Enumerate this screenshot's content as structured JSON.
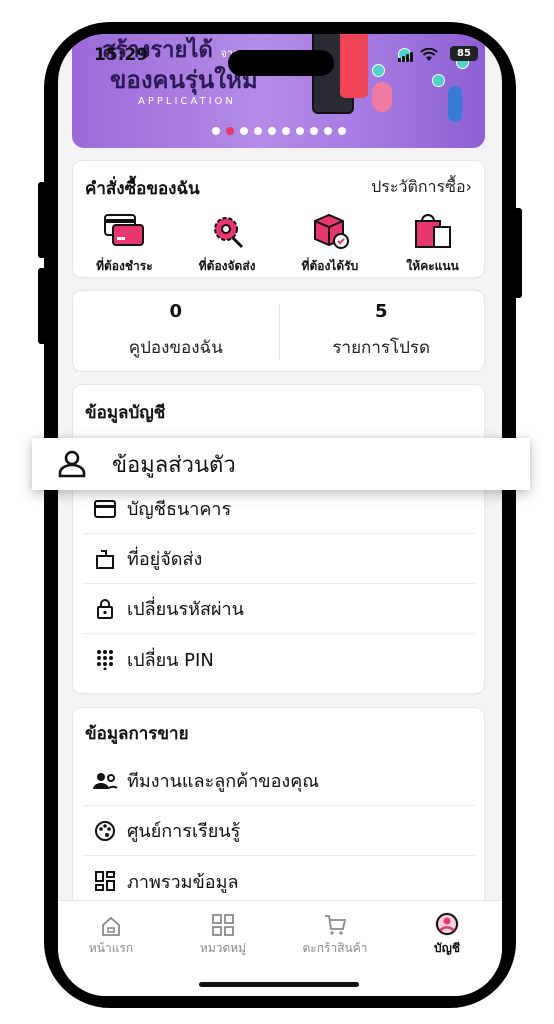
{
  "status": {
    "time": "15:29",
    "battery": "85"
  },
  "banner": {
    "line1": "สร้างรายได้",
    "line1_small": "จาก แอพ",
    "line2": "ของคนรุ่นใหม่",
    "line3": "APPLICATION",
    "dot_count": 10,
    "active_dot": 1
  },
  "orders": {
    "title": "คำสั่งซื้อของฉัน",
    "history_link": "ประวัติการซื้อ",
    "chevron": "›",
    "items": [
      {
        "label": "ที่ต้องชำระ",
        "icon": "card-pay-icon"
      },
      {
        "label": "ที่ต้องจัดส่ง",
        "icon": "gear-ship-icon"
      },
      {
        "label": "ที่ต้องได้รับ",
        "icon": "box-receive-icon"
      },
      {
        "label": "ให้คะแนน",
        "icon": "bag-rate-icon"
      }
    ]
  },
  "stats": [
    {
      "value": "0",
      "label": "คูปองของฉัน"
    },
    {
      "value": "5",
      "label": "รายการโปรด"
    }
  ],
  "account": {
    "title": "ข้อมูลบัญชี",
    "items": [
      {
        "label": "บัญชีธนาคาร",
        "icon": "credit-card-icon"
      },
      {
        "label": "ที่อยู่จัดส่ง",
        "icon": "address-icon"
      },
      {
        "label": "เปลี่ยนรหัสผ่าน",
        "icon": "lock-icon"
      },
      {
        "label": "เปลี่ยน PIN",
        "icon": "keypad-icon"
      }
    ]
  },
  "popup": {
    "label": "ข้อมูลส่วนตัว",
    "icon": "person-icon"
  },
  "sales": {
    "title": "ข้อมูลการขาย",
    "items": [
      {
        "label": "ทีมงานและลูกค้าของคุณ",
        "icon": "team-icon"
      },
      {
        "label": "ศูนย์การเรียนรู้",
        "icon": "palette-icon"
      },
      {
        "label": "ภาพรวมข้อมูล",
        "icon": "dashboard-icon"
      }
    ]
  },
  "tabs": [
    {
      "label": "หน้าแรก",
      "icon": "home-icon"
    },
    {
      "label": "หมวดหมู่",
      "icon": "grid-icon"
    },
    {
      "label": "ตะกร้าสินค้า",
      "icon": "cart-icon"
    },
    {
      "label": "บัญชี",
      "icon": "account-icon",
      "active": true
    }
  ],
  "colors": {
    "accent": "#e8366e",
    "banner": "#a57ce3"
  }
}
